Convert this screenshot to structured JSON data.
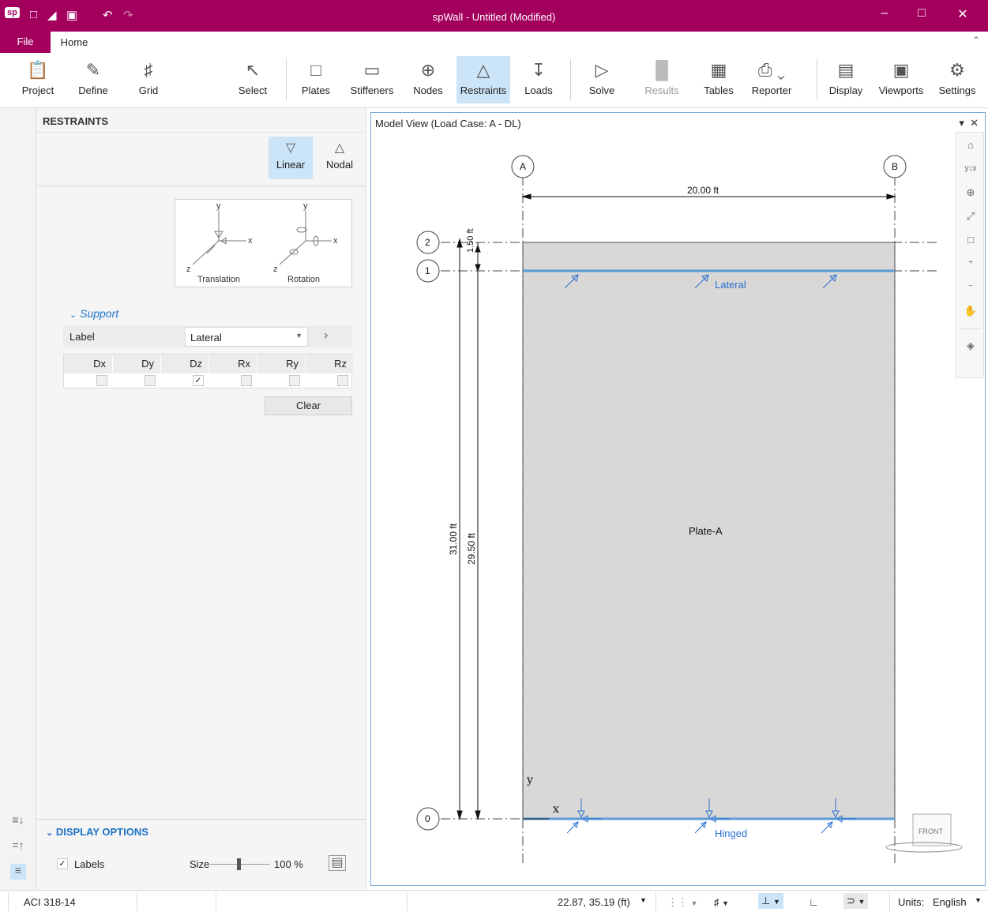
{
  "app": {
    "logo": "sp",
    "title": "spWall - Untitled (Modified)"
  },
  "tabs": {
    "file": "File",
    "home": "Home"
  },
  "ribbon": {
    "project": "Project",
    "define": "Define",
    "grid": "Grid",
    "select": "Select",
    "plates": "Plates",
    "stiffeners": "Stiffeners",
    "nodes": "Nodes",
    "restraints": "Restraints",
    "loads": "Loads",
    "solve": "Solve",
    "results": "Results",
    "tables": "Tables",
    "reporter": "Reporter",
    "display": "Display",
    "viewports": "Viewports",
    "settings": "Settings"
  },
  "panel": {
    "title": "RESTRAINTS",
    "tab_linear": "Linear",
    "tab_nodal": "Nodal",
    "diagram": {
      "y1": "y",
      "x1": "x",
      "z1": "z",
      "caption1": "Translation",
      "y2": "y",
      "x2": "x",
      "z2": "z",
      "caption2": "Rotation"
    },
    "support_header": "Support",
    "label_caption": "Label",
    "label_value": "Lateral",
    "columns": [
      "Dx",
      "Dy",
      "Dz",
      "Rx",
      "Ry",
      "Rz"
    ],
    "checks": [
      false,
      false,
      true,
      false,
      false,
      false
    ],
    "clear_label": "Clear",
    "display_options": "DISPLAY OPTIONS",
    "labels_caption": "Labels",
    "labels_checked": true,
    "size_caption": "Size",
    "size_value": "100 %",
    "size_fraction": 0.47
  },
  "model_view": {
    "title": "Model View (Load Case: A - DL)",
    "grid_a": "A",
    "grid_b": "B",
    "grid_2": "2",
    "grid_1": "1",
    "grid_0": "0",
    "dim_width": "20.00 ft",
    "dim_top": "1.50 ft",
    "dim_total": "31.00 ft",
    "dim_mid": "29.50 ft",
    "plate_label": "Plate-A",
    "support_top": "Lateral",
    "support_bottom": "Hinged",
    "axis_y": "y",
    "axis_x": "x",
    "cube": "FRONT"
  },
  "status": {
    "code": "ACI 318-14",
    "coords": "22.87, 35.19 (ft)",
    "units_label": "Units:",
    "units_value": "English"
  },
  "colors": {
    "brand": "#a3005d",
    "accent": "#1f73c7",
    "plate": "#d9d8d6",
    "gridBubble": "#c0392b"
  }
}
